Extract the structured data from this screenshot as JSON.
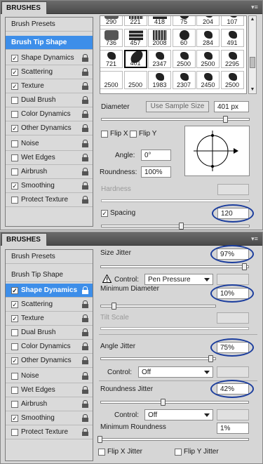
{
  "panels": [
    {
      "tab": "BRUSHES",
      "sidebar": [
        {
          "label": "Brush Presets",
          "check": null,
          "lock": false,
          "sel": false
        },
        {
          "label": "Brush Tip Shape",
          "check": null,
          "lock": false,
          "sel": true
        },
        {
          "label": "Shape Dynamics",
          "check": true,
          "lock": true,
          "sel": false
        },
        {
          "label": "Scattering",
          "check": true,
          "lock": true,
          "sel": false
        },
        {
          "label": "Texture",
          "check": true,
          "lock": true,
          "sel": false
        },
        {
          "label": "Dual Brush",
          "check": false,
          "lock": true,
          "sel": false
        },
        {
          "label": "Color Dynamics",
          "check": false,
          "lock": true,
          "sel": false
        },
        {
          "label": "Other Dynamics",
          "check": true,
          "lock": true,
          "sel": false
        },
        {
          "label": "Noise",
          "check": false,
          "lock": true,
          "sel": false
        },
        {
          "label": "Wet Edges",
          "check": false,
          "lock": true,
          "sel": false
        },
        {
          "label": "Airbrush",
          "check": false,
          "lock": true,
          "sel": false
        },
        {
          "label": "Smoothing",
          "check": true,
          "lock": true,
          "sel": false
        },
        {
          "label": "Protect Texture",
          "check": false,
          "lock": true,
          "sel": false
        }
      ],
      "brushes": [
        "290",
        "221",
        "418",
        "75",
        "204",
        "107",
        "736",
        "457",
        "2008",
        "60",
        "284",
        "491",
        "721",
        "401",
        "2347",
        "2500",
        "2500",
        "2295",
        "2500",
        "2500",
        "1983",
        "2307",
        "2450",
        "2500"
      ],
      "diameter_label": "Diameter",
      "use_sample_size": "Use Sample Size",
      "diameter_value": "401 px",
      "flip_x": "Flip X",
      "flip_y": "Flip Y",
      "angle_label": "Angle:",
      "angle_value": "0°",
      "roundness_label": "Roundness:",
      "roundness_value": "100%",
      "hardness_label": "Hardness",
      "spacing_label": "Spacing",
      "spacing_value": "120"
    },
    {
      "tab": "BRUSHES",
      "sidebar": [
        {
          "label": "Brush Presets",
          "check": null,
          "lock": false,
          "sel": false
        },
        {
          "label": "Brush Tip Shape",
          "check": null,
          "lock": false,
          "sel": false
        },
        {
          "label": "Shape Dynamics",
          "check": true,
          "lock": true,
          "sel": true
        },
        {
          "label": "Scattering",
          "check": true,
          "lock": true,
          "sel": false
        },
        {
          "label": "Texture",
          "check": true,
          "lock": true,
          "sel": false
        },
        {
          "label": "Dual Brush",
          "check": false,
          "lock": true,
          "sel": false
        },
        {
          "label": "Color Dynamics",
          "check": false,
          "lock": true,
          "sel": false
        },
        {
          "label": "Other Dynamics",
          "check": true,
          "lock": true,
          "sel": false
        },
        {
          "label": "Noise",
          "check": false,
          "lock": true,
          "sel": false
        },
        {
          "label": "Wet Edges",
          "check": false,
          "lock": true,
          "sel": false
        },
        {
          "label": "Airbrush",
          "check": false,
          "lock": true,
          "sel": false
        },
        {
          "label": "Smoothing",
          "check": true,
          "lock": true,
          "sel": false
        },
        {
          "label": "Protect Texture",
          "check": false,
          "lock": true,
          "sel": false
        }
      ],
      "size_jitter_label": "Size Jitter",
      "size_jitter_value": "97%",
      "control_label": "Control:",
      "control1_value": "Pen Pressure",
      "min_diameter_label": "Minimum Diameter",
      "min_diameter_value": "10%",
      "tilt_scale_label": "Tilt Scale",
      "angle_jitter_label": "Angle Jitter",
      "angle_jitter_value": "75%",
      "control2_value": "Off",
      "roundness_jitter_label": "Roundness Jitter",
      "roundness_jitter_value": "42%",
      "control3_value": "Off",
      "min_roundness_label": "Minimum Roundness",
      "min_roundness_value": "1%",
      "flip_x_jitter": "Flip X Jitter",
      "flip_y_jitter": "Flip Y Jitter"
    }
  ],
  "accent": "#3d8ee9",
  "annotation_color": "#1c3e9e"
}
